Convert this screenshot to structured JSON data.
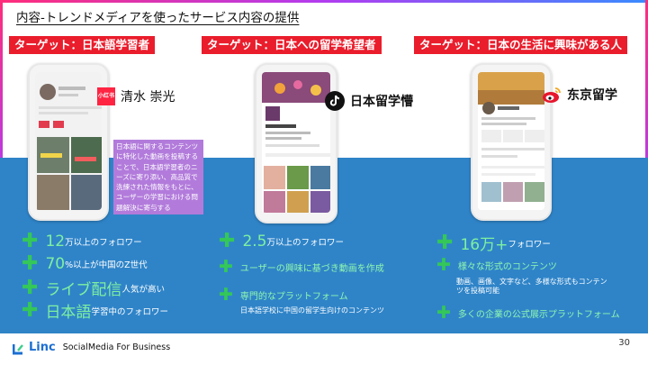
{
  "slide": {
    "title": "内容-トレンドメディアを使ったサービス内容の提供",
    "page_number": "30"
  },
  "columns": [
    {
      "tag": "ターゲット：日本語学習者",
      "brand_name": "清水 崇光",
      "brand_icon": "xiaohongshu-icon",
      "brand_icon_text": "小红书",
      "description": "日本語に関するコンテンツに特化した動画を投稿することで、日本語学習者のニーズに寄り添い、高品質で洗練された情報をもとに、ユーザーの学習における問題解決に寄与する",
      "features": [
        {
          "big": "12",
          "small": " 万以上のフォロワー"
        },
        {
          "big": "70",
          "small": "%以上が中国のZ世代"
        },
        {
          "big": "ライブ配信",
          "small": " 人気が高い"
        },
        {
          "big": "日本語",
          "small": " 学習中のフォロワー"
        }
      ]
    },
    {
      "tag": "ターゲット：日本への留学希望者",
      "brand_name": "日本留学懵",
      "brand_icon": "tiktok-icon",
      "features": [
        {
          "big": "2.5",
          "small": "万以上のフォロワー"
        },
        {
          "green": "ユーザーの興味に基づき動画を作成"
        },
        {
          "green": "専門的なプラットフォーム"
        }
      ],
      "feature_note": "日本語学校に中国の留学生向けのコンテンツ"
    },
    {
      "tag": "ターゲット：日本の生活に興味がある人",
      "brand_name": "东京留学",
      "brand_icon": "weibo-icon",
      "features": [
        {
          "big": "16万+",
          "small": "フォロワー"
        },
        {
          "green": "様々な形式のコンテンツ"
        },
        {
          "green": "多くの企業の公式展示プラットフォーム"
        }
      ],
      "feature_note": "動画、画像、文字など、多様な形式もコンテンツを投稿可能"
    }
  ],
  "footer": {
    "logo_text": "Linc",
    "logo_sub": "SocialMedia For Business"
  },
  "colors": {
    "tag_red": "#ea1d2c",
    "band_blue": "#2f84c8",
    "plus_green": "#34c759",
    "desc_purple": "#b27bdb",
    "brand_blue": "#1c6fd1"
  }
}
